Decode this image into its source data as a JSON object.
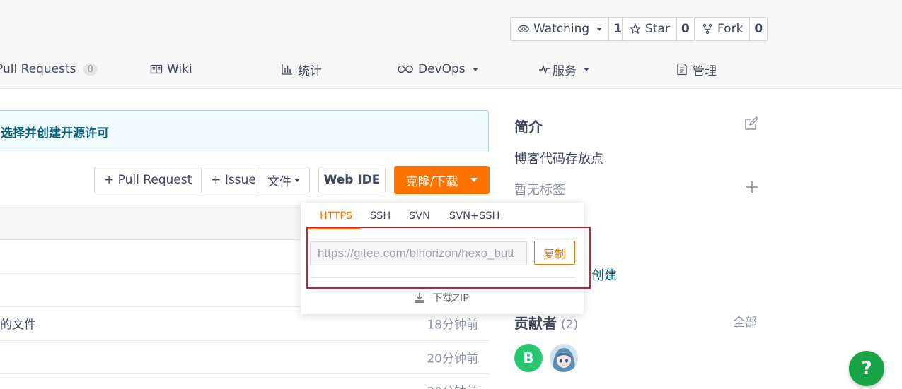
{
  "header": {
    "watching": {
      "label": "Watching",
      "count": "1",
      "icon": "eye-icon"
    },
    "star": {
      "label": "Star",
      "count": "0",
      "icon": "star-icon"
    },
    "fork": {
      "label": "Fork",
      "count": "0",
      "icon": "fork-icon"
    }
  },
  "nav": {
    "pull_requests": {
      "label": "Pull Requests",
      "count": "0"
    },
    "wiki": {
      "label": "Wiki",
      "icon": "book-icon"
    },
    "stats": {
      "label": "统计",
      "icon": "bar-chart-icon"
    },
    "devops": {
      "label": "DevOps",
      "icon": "infinity-icon"
    },
    "services": {
      "label": "服务",
      "icon": "pulse-icon"
    },
    "manage": {
      "label": "管理",
      "icon": "document-icon"
    }
  },
  "notice": {
    "text": "选择并创建开源许可"
  },
  "actions": {
    "pull_request": "+ Pull Request",
    "issue": "+ Issue",
    "file": "文件",
    "web_ide": "Web IDE",
    "clone": "克隆/下载"
  },
  "files": [
    {
      "name": "",
      "time": ""
    },
    {
      "name": "",
      "time": ""
    },
    {
      "name": "的文件",
      "time": "18分钟前"
    },
    {
      "name": "",
      "time": "20分钟前"
    },
    {
      "name": "",
      "time": "20分钟前"
    }
  ],
  "clone_dropdown": {
    "tabs": [
      "HTTPS",
      "SSH",
      "SVN",
      "SVN+SSH"
    ],
    "active_tab": "HTTPS",
    "url": "https://gitee.com/blhorizon/hexo_butt",
    "copy_label": "复制",
    "download_zip": "下载ZIP"
  },
  "sidebar": {
    "intro_title": "简介",
    "description": "博客代码存放点",
    "tags": "暂无标签",
    "link_text": "创建",
    "contributors_title": "贡献者",
    "contributors_count": "(2)",
    "all_label": "全部",
    "contributor_initial": "B"
  },
  "help": {
    "label": "?"
  },
  "colors": {
    "accent": "#fe7300",
    "link": "#0a5d76",
    "help": "#1aa448",
    "highlight": "#d0202f"
  }
}
